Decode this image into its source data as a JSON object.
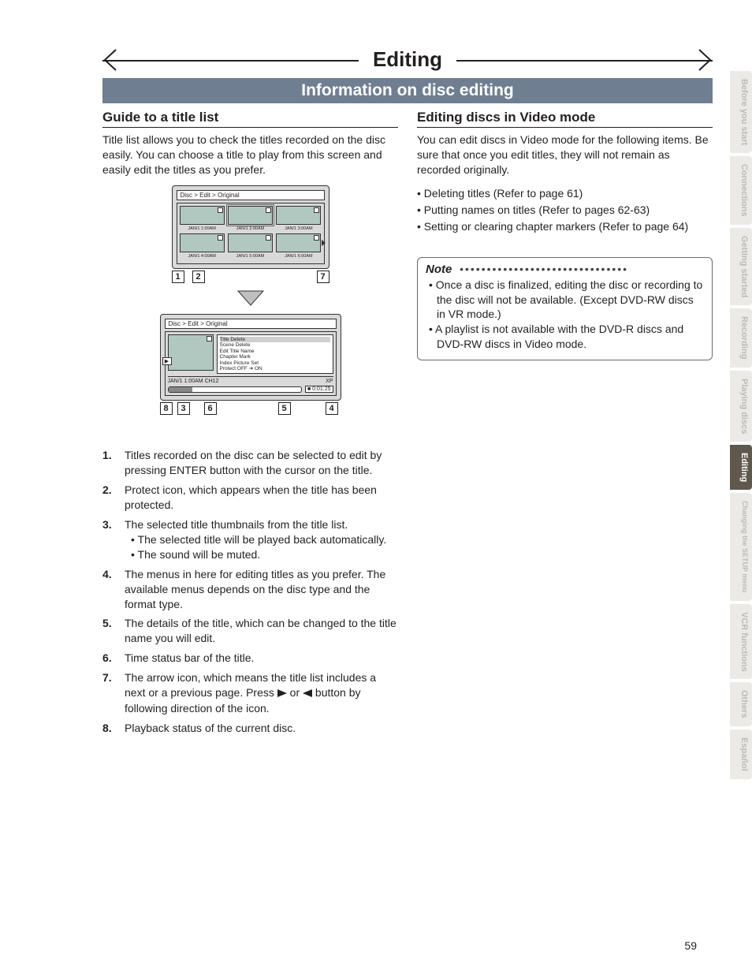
{
  "chapter_title": "Editing",
  "section_title": "Information on disc editing",
  "left": {
    "subhead": "Guide to a title list",
    "intro": "Title list allows you to check the titles recorded on the disc easily. You can choose a title to play from this screen and easily edit the titles as you prefer.",
    "screen_breadcrumb": "Disc > Edit > Original",
    "thumbs": [
      "JAN/1  1:00AM",
      "JAN/1  2:00AM",
      "JAN/1  3:00AM",
      "JAN/1  4:00AM",
      "JAN/1  5:00AM",
      "JAN/1  6:00AM"
    ],
    "callouts1": [
      "1",
      "2",
      "7"
    ],
    "menu_items": [
      "Title Delete",
      "Scene Delete",
      "Edit Title Name",
      "Chapter Mark",
      "Index Picture Set",
      "Protect OFF ➔ ON"
    ],
    "info_line_left": "JAN/1  1:00AM  CH12",
    "info_line_right": "XP",
    "time_display": "0:01:25",
    "callouts2": [
      "8",
      "3",
      "6",
      "5",
      "4"
    ],
    "list": [
      {
        "n": "1.",
        "t": "Titles recorded on the disc can be selected to edit by pressing ENTER button with the cursor on the title."
      },
      {
        "n": "2.",
        "t": "Protect icon, which appears when the title has been protected."
      },
      {
        "n": "3.",
        "t": "The selected title thumbnails from the title list.",
        "sub": [
          "• The selected title will be played back automatically.",
          "• The sound will be muted."
        ]
      },
      {
        "n": "4.",
        "t": "The menus in here for editing titles as you prefer. The available menus depends on the disc type and the format type."
      },
      {
        "n": "5.",
        "t": "The details of the title, which can be changed to the title name you will edit."
      },
      {
        "n": "6.",
        "t": "Time status bar of the title."
      },
      {
        "n": "7.",
        "t_pre": "The arrow icon, which means the title list includes a next or a previous page. Press ",
        "t_mid": " or ",
        "t_post": " button by following direction of the icon."
      },
      {
        "n": "8.",
        "t": "Playback status of the current disc."
      }
    ]
  },
  "right": {
    "subhead": "Editing discs in Video mode",
    "intro": "You can edit discs in Video mode for the following items. Be sure that once you edit titles, they will not remain as recorded originally.",
    "bullets": [
      "Deleting titles (Refer to page 61)",
      "Putting names on titles (Refer to pages 62-63)",
      "Setting or clearing chapter markers (Refer to page 64)"
    ],
    "note_title": "Note",
    "note_items": [
      "Once a disc is finalized, editing the disc or recording to the disc will not be available. (Except DVD-RW discs in VR mode.)",
      "A playlist is not available with the DVD-R discs and DVD-RW discs in Video mode."
    ]
  },
  "tabs": [
    {
      "label": "Before you start",
      "active": false
    },
    {
      "label": "Connections",
      "active": false
    },
    {
      "label": "Getting started",
      "active": false
    },
    {
      "label": "Recording",
      "active": false
    },
    {
      "label": "Playing discs",
      "active": false
    },
    {
      "label": "Editing",
      "active": true
    },
    {
      "label": "Changing the SETUP menu",
      "active": false
    },
    {
      "label": "VCR functions",
      "active": false
    },
    {
      "label": "Others",
      "active": false
    },
    {
      "label": "Español",
      "active": false
    }
  ],
  "page_number": "59"
}
